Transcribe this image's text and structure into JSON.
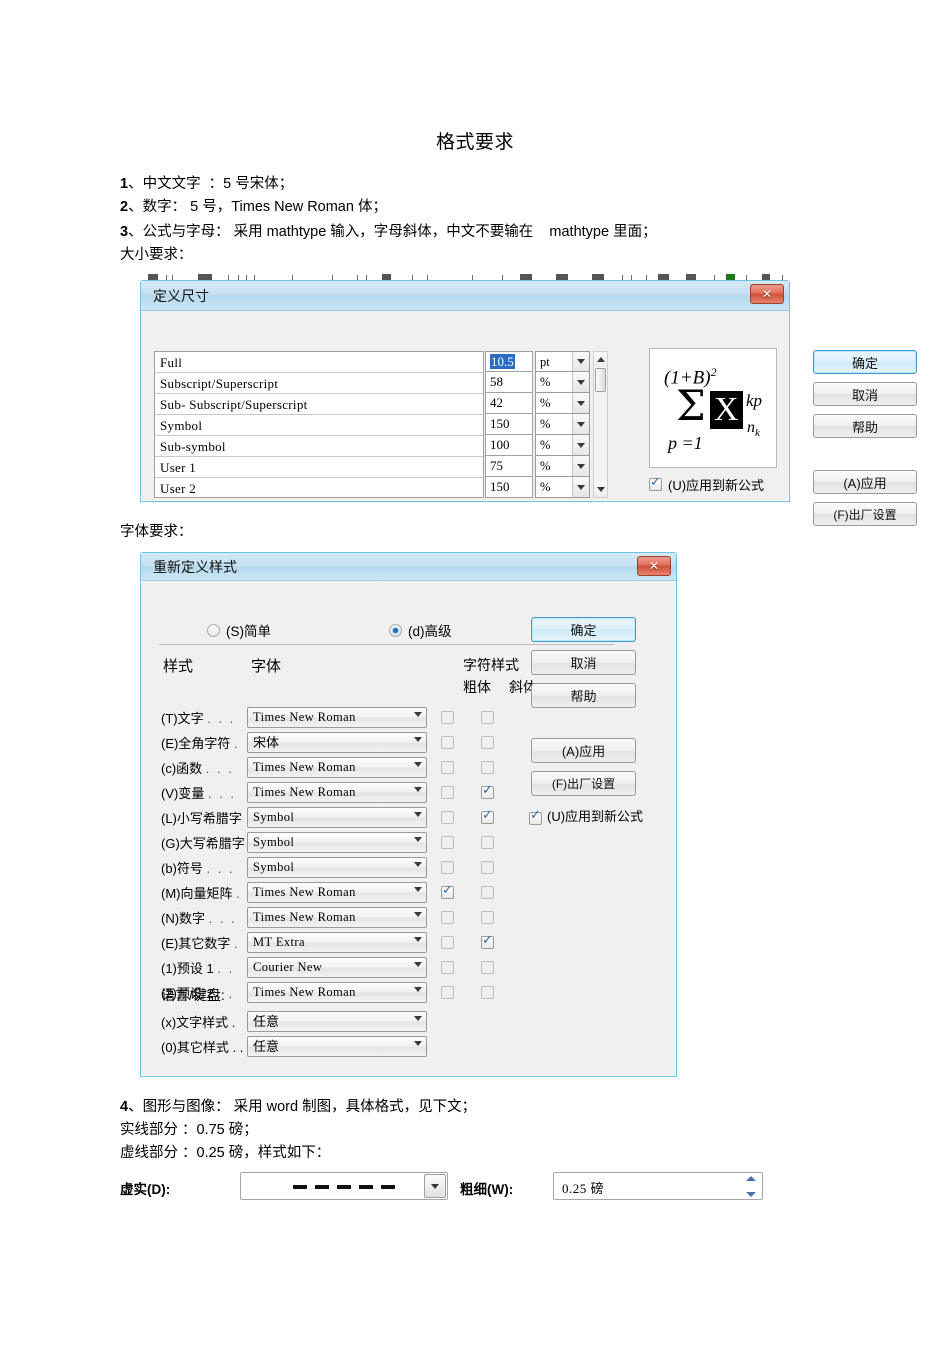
{
  "document": {
    "title": "格式要求",
    "lines": [
      {
        "num": "1",
        "text": "、中文文字  ：5 号宋体；"
      },
      {
        "num": "2",
        "text": "、数字： 5 号，Times New Roman 体；"
      },
      {
        "num": "3",
        "text": "、公式与字母： 采用 mathtype 输入，字母斜体，中文不要输在    mathtype 里面；"
      },
      {
        "num": "",
        "text": "大小要求："
      }
    ],
    "font_req_label": "字体要求：",
    "lines2": [
      {
        "num": "4",
        "text": "、图形与图像： 采用 word 制图，具体格式，见下文；"
      },
      {
        "num": "",
        "text": "实线部分 ：0.75 磅；"
      },
      {
        "num": "",
        "text": "虚线部分 ：0.25 磅，样式如下："
      }
    ]
  },
  "dialog_size": {
    "title": "定义尺寸",
    "close_label": "✕",
    "rows": [
      {
        "name": "Full",
        "value": "10.5",
        "unit": "pt",
        "selected": true
      },
      {
        "name": "Subscript/Superscript",
        "value": "58",
        "unit": "%",
        "selected": false
      },
      {
        "name": "Sub- Subscript/Superscript",
        "value": "42",
        "unit": "%",
        "selected": false
      },
      {
        "name": "Symbol",
        "value": "150",
        "unit": "%",
        "selected": false
      },
      {
        "name": "Sub-symbol",
        "value": "100",
        "unit": "%",
        "selected": false
      },
      {
        "name": "User 1",
        "value": "75",
        "unit": "%",
        "selected": false
      },
      {
        "name": "User 2",
        "value": "150",
        "unit": "%",
        "selected": false
      }
    ],
    "preview": {
      "power": "(1+B)",
      "power_exp": "2",
      "sigma": "Σ",
      "highlighted": "X",
      "superscript": "kp",
      "subscript": "n",
      "subscript_sub": "k",
      "lower_limit": "p =1"
    },
    "apply_new_checkbox": {
      "label": "(U)应用到新公式",
      "checked": true
    },
    "buttons": [
      {
        "label": "确定",
        "default": true
      },
      {
        "label": "取消",
        "default": false
      },
      {
        "label": "帮助",
        "default": false
      },
      {
        "label": "(A)应用",
        "default": false
      },
      {
        "label": "(F)出厂设置",
        "default": false
      }
    ]
  },
  "dialog_style": {
    "title": "重新定义样式",
    "close_label": "✕",
    "modes": [
      {
        "label": "(S)简单",
        "selected": false
      },
      {
        "label": "(d)高级",
        "selected": true
      }
    ],
    "headers": {
      "style": "样式",
      "font": "字体",
      "char_style": "字符样式",
      "bold": "粗体",
      "italic": "斜体"
    },
    "rows": [
      {
        "label": "(T)文字",
        "dots": ". . .",
        "font": "Times New Roman",
        "cjk": false,
        "bold": false,
        "italic": false
      },
      {
        "label": "(E)全角字符",
        "dots": ".",
        "font": "宋体",
        "cjk": true,
        "bold": false,
        "italic": false
      },
      {
        "label": "(c)函数",
        "dots": ". . .",
        "font": "Times New Roman",
        "cjk": false,
        "bold": false,
        "italic": false
      },
      {
        "label": "(V)变量",
        "dots": ". . .",
        "font": "Times New Roman",
        "cjk": false,
        "bold": false,
        "italic": true
      },
      {
        "label": "(L)小写希腊字",
        "dots": "",
        "font": "Symbol",
        "cjk": false,
        "bold": false,
        "italic": true
      },
      {
        "label": "(G)大写希腊字",
        "dots": "",
        "font": "Symbol",
        "cjk": false,
        "bold": false,
        "italic": false
      },
      {
        "label": "(b)符号",
        "dots": ". . .",
        "font": "Symbol",
        "cjk": false,
        "bold": false,
        "italic": false
      },
      {
        "label": "(M)向量矩阵",
        "dots": ".",
        "font": "Times New Roman",
        "cjk": false,
        "bold": true,
        "italic": false
      },
      {
        "label": "(N)数字",
        "dots": ". . .",
        "font": "Times New Roman",
        "cjk": false,
        "bold": false,
        "italic": false
      },
      {
        "label": "(E)其它数字",
        "dots": ".",
        "font": "MT Extra",
        "cjk": false,
        "bold": false,
        "italic": true
      },
      {
        "label": "(1)预设 1",
        "dots": ". .",
        "font": "Courier New",
        "cjk": false,
        "bold": false,
        "italic": false
      },
      {
        "label": "(2)预设 2",
        "dots": ". .",
        "font": "Times New Roman",
        "cjk": false,
        "bold": false,
        "italic": false
      }
    ],
    "language_header": "语言/键盘:",
    "language_rows": [
      {
        "label": "(x)文字样式",
        "dots": ".",
        "value": "任意"
      },
      {
        "label": "(0)其它样式",
        "dots": ". .",
        "value": "任意"
      }
    ],
    "buttons": [
      {
        "label": "确定",
        "default": true
      },
      {
        "label": "取消",
        "default": false
      },
      {
        "label": "帮助",
        "default": false
      },
      {
        "label": "(A)应用",
        "default": false
      },
      {
        "label": "(F)出厂设置",
        "default": false
      }
    ],
    "apply_new_checkbox": {
      "label": "(U)应用到新公式",
      "checked": true
    }
  },
  "line_style": {
    "dash_label": "虚实(D):",
    "dash_value": "dashed-line",
    "weight_label": "粗细(W):",
    "weight_value": "0.25 磅"
  },
  "colors": {
    "dialog_border": "#6cc3e0",
    "titlebar": "#c4e0f0",
    "close_button": "#cf4f38",
    "default_button_border": "#3c9fd4",
    "selection": "#2a6cc4",
    "check": "#2f68a8"
  }
}
